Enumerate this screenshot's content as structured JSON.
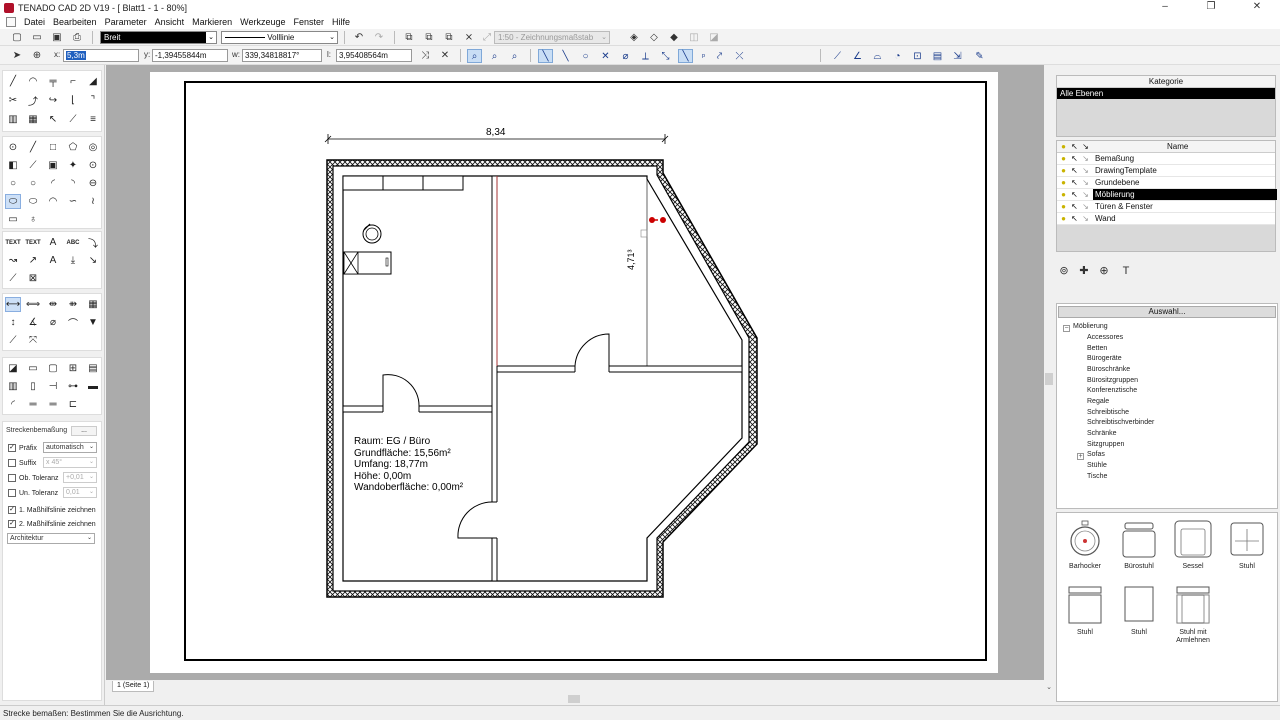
{
  "window": {
    "title": "TENADO CAD 2D V19 - [ Blatt1 - 1 - 80%]",
    "controls": [
      "–",
      "❐",
      "✕"
    ]
  },
  "menu": [
    "Datei",
    "Bearbeiten",
    "Parameter",
    "Ansicht",
    "Markieren",
    "Werkzeuge",
    "Fenster",
    "Hilfe"
  ],
  "toolbar": {
    "pen_width": "Breit",
    "line_type": "Volllinie",
    "scale": "1:50 - Zeichnungsmaßstab"
  },
  "coords": {
    "x_label": "x:",
    "x_value": "5,3m",
    "y_label": "y:",
    "y_value": "-1,39455844m",
    "w_label": "w:",
    "w_value": "339,34818817°",
    "l_label": "l:",
    "l_value": "3,95408564m"
  },
  "properties": {
    "title": "Streckenbemaßung",
    "more": "...",
    "prefix_label": "Präfix",
    "prefix_value": "automatisch",
    "suffix_label": "Suffix",
    "suffix_value": "x 45°",
    "upper_tol_label": "Ob. Toleranz",
    "upper_tol_value": "+0,01",
    "lower_tol_label": "Un. Toleranz",
    "lower_tol_value": "0,01",
    "helper1_label": "1. Maßhilfslinie zeichnen",
    "helper2_label": "2. Maßhilfslinie zeichnen",
    "style_value": "Architektur"
  },
  "drawing": {
    "dimension_top": "8,34",
    "dimension_side": "4,71³",
    "room_info": [
      "Raum: EG / Büro",
      "Grundfläche: 15,56m²",
      "Umfang: 18,77m",
      "Höhe: 0,00m",
      "Wandoberfläche: 0,00m²"
    ]
  },
  "page_tab": "1 (Seite 1)",
  "category": {
    "header": "Kategorie",
    "selected": "Alle Ebenen"
  },
  "layers": {
    "header": "Name",
    "items": [
      {
        "name": "Bemaßung",
        "selected": false
      },
      {
        "name": "DrawingTemplate",
        "selected": false
      },
      {
        "name": "Grundebene",
        "selected": false
      },
      {
        "name": "Möblierung",
        "selected": true
      },
      {
        "name": "Türen & Fenster",
        "selected": false
      },
      {
        "name": "Wand",
        "selected": false
      }
    ]
  },
  "selection": {
    "button": "Auswahl...",
    "root": "Möblierung",
    "children": [
      "Accessores",
      "Betten",
      "Bürogeräte",
      "Büroschränke",
      "Bürositzgruppen",
      "Konferenztische",
      "Regale",
      "Schreibtische",
      "Schreibtischverbinder",
      "Schränke",
      "Sitzgruppen",
      "Sofas",
      "Stühle",
      "Tische"
    ]
  },
  "symbols": [
    "Barhocker",
    "Bürostuhl",
    "Sessel",
    "Stuhl",
    "Stuhl",
    "Stuhl",
    "Stuhl mit Armlehnen"
  ],
  "status": "Strecke bemaßen: Bestimmen Sie die Ausrichtung."
}
